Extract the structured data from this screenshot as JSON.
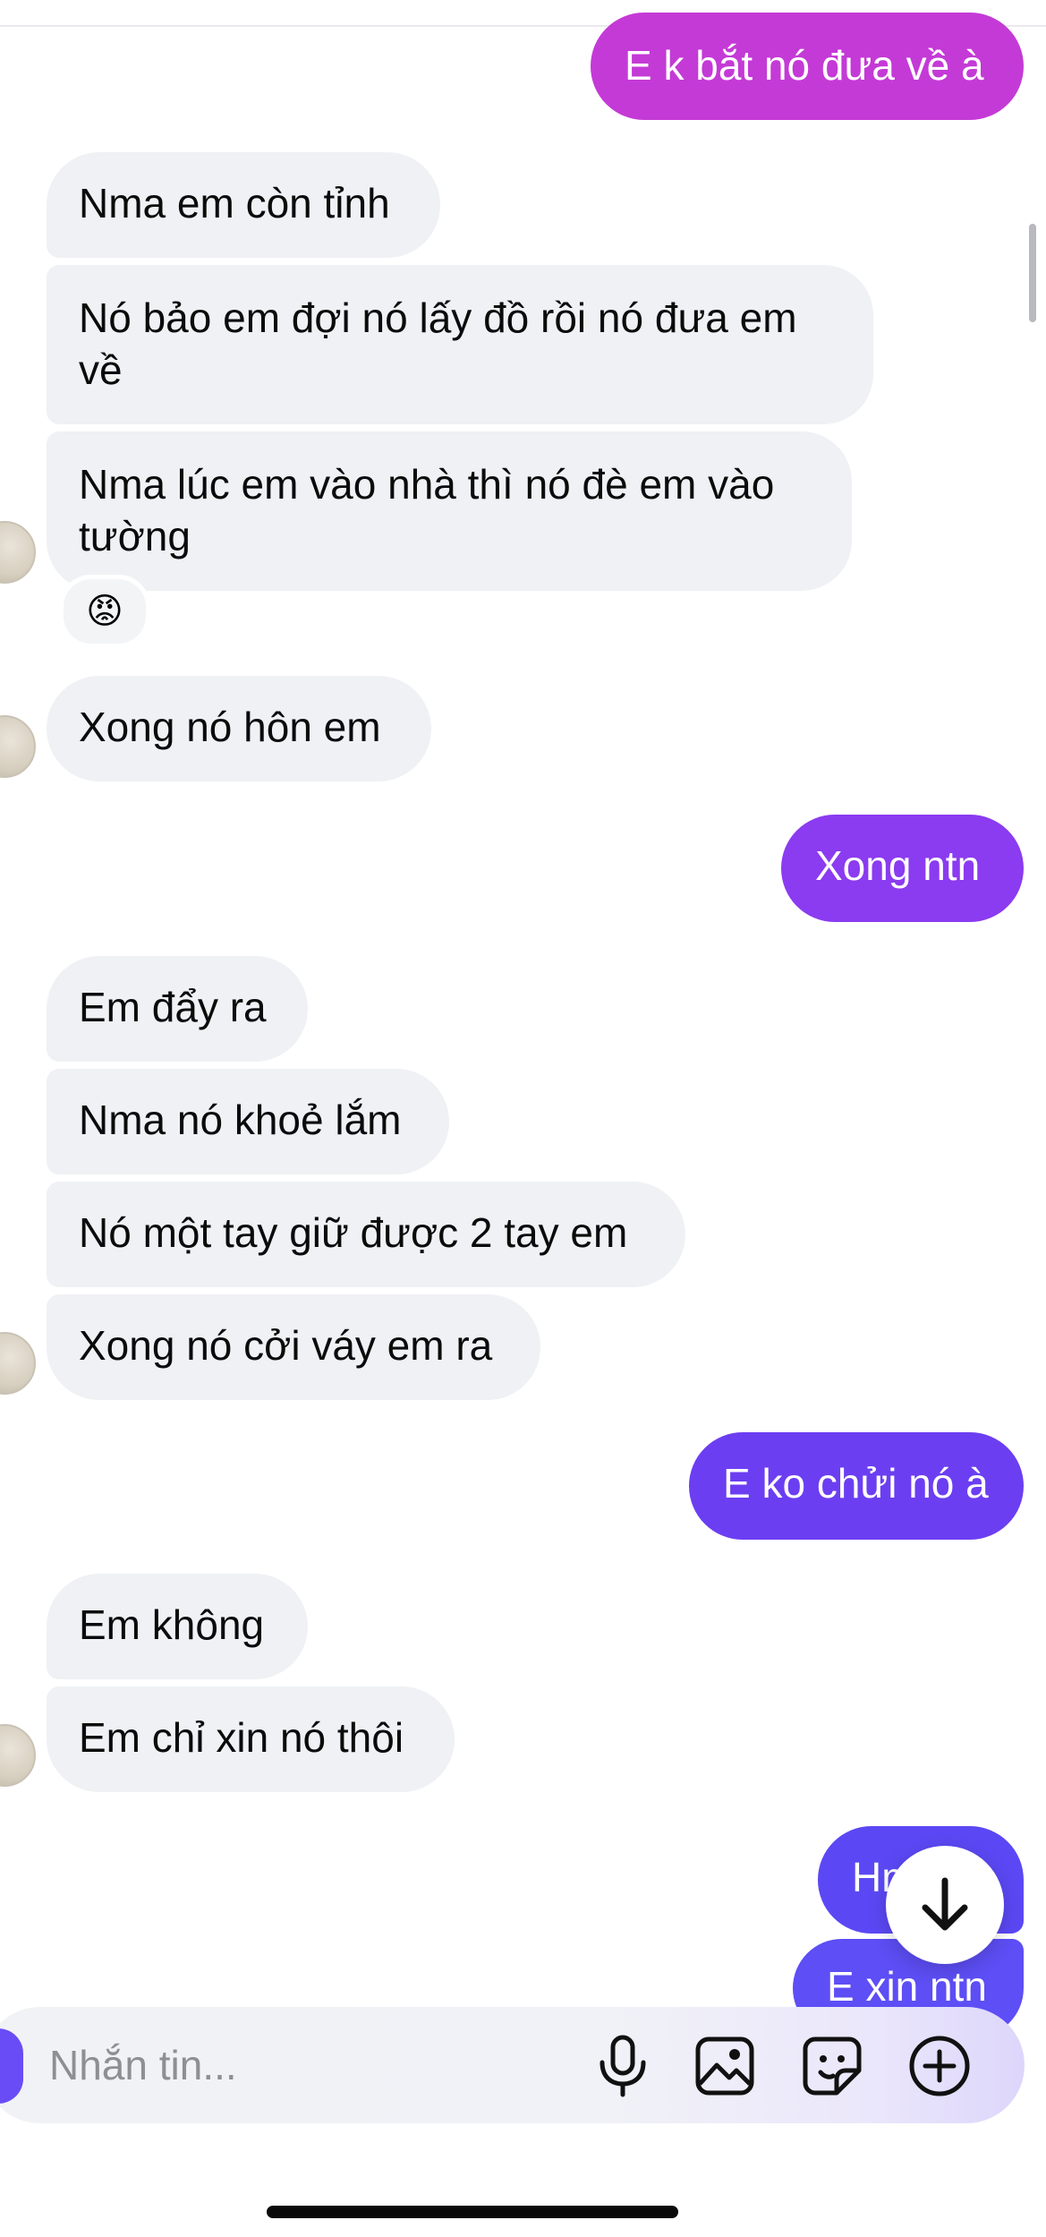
{
  "messages": [
    {
      "text": "E k bắt nó đưa về à",
      "from": "me",
      "color": "#c43ad6"
    },
    {
      "text": "Nma em còn tỉnh",
      "from": "them"
    },
    {
      "text": "Nó bảo em đợi nó lấy đồ rồi nó đưa em về",
      "from": "them"
    },
    {
      "text": "Nma lúc em vào nhà thì nó đè em vào tường",
      "from": "them"
    },
    {
      "text": "Xong nó hôn em",
      "from": "them"
    },
    {
      "text": "Xong ntn",
      "from": "me",
      "color": "#8b3bf0"
    },
    {
      "text": "Em đẩy ra",
      "from": "them"
    },
    {
      "text": "Nma nó khoẻ lắm",
      "from": "them"
    },
    {
      "text": "Nó một tay giữ được 2 tay em",
      "from": "them"
    },
    {
      "text": "Xong nó cởi váy em ra",
      "from": "them"
    },
    {
      "text": "E ko chửi nó à",
      "from": "me",
      "color": "#6c3ef2"
    },
    {
      "text": "Em không",
      "from": "them"
    },
    {
      "text": "Em chỉ xin nó thôi",
      "from": "them"
    },
    {
      "text": "Hm",
      "from": "me",
      "color": "#5b48f4"
    },
    {
      "text": "E xin ntn",
      "from": "me",
      "color": "#5d4ef5"
    }
  ],
  "reaction": {
    "emoji": "angry-face",
    "glyph": "😡"
  },
  "composer": {
    "placeholder": "Nhắn tin..."
  },
  "icons": {
    "mic": "microphone-icon",
    "gallery": "image-icon",
    "sticker": "sticker-icon",
    "add": "plus-circle-icon",
    "scroll_down": "arrow-down-icon"
  }
}
